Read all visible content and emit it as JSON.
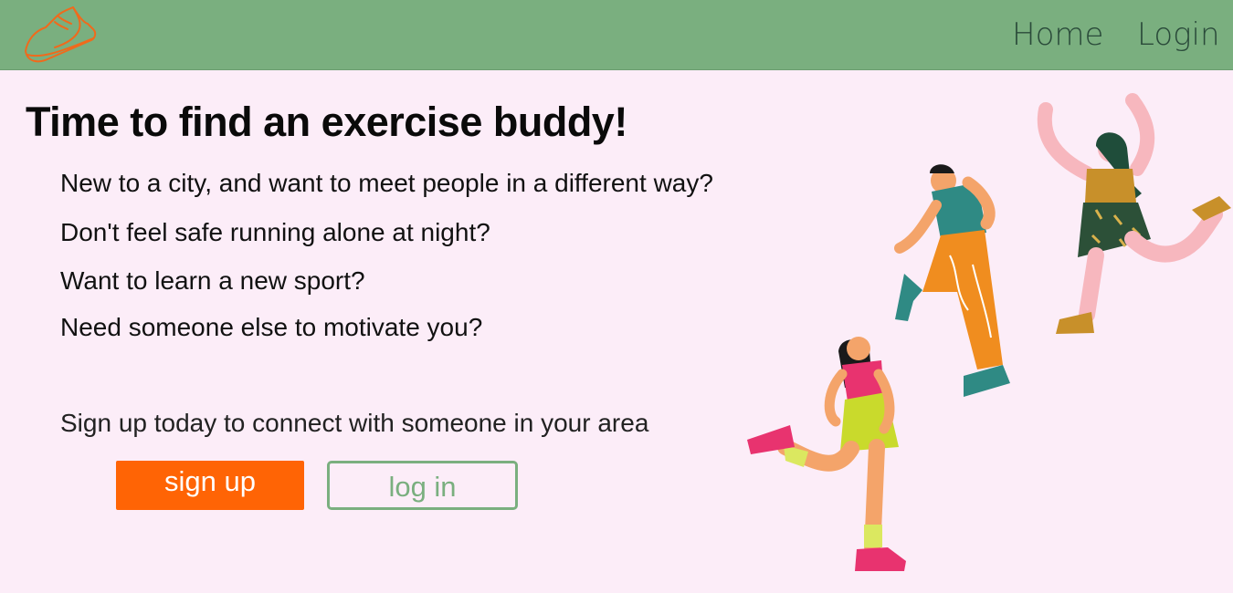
{
  "nav": {
    "logo_icon": "sneaker-icon",
    "home_label": "Home",
    "login_label": "Login"
  },
  "hero": {
    "headline": "Time to find an exercise buddy!",
    "questions": [
      "New to a city, and want to meet people in a different way?",
      "Don't feel safe running alone at night?",
      "Want to learn a new sport?",
      "Need someone else to motivate you?"
    ],
    "cta_text": "Sign up today to connect with someone in your area",
    "signup_label": "sign up",
    "login_label": "log in"
  },
  "colors": {
    "navbar": "#7aaf7f",
    "background": "#fcedf8",
    "accent": "#ff6405"
  }
}
